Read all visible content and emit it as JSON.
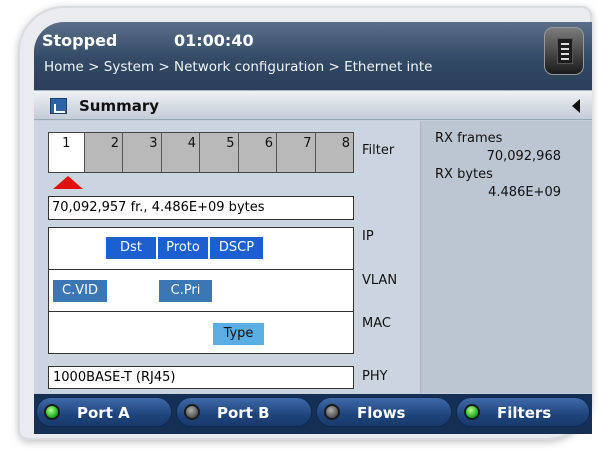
{
  "header": {
    "status": "Stopped",
    "time": "01:00:40",
    "breadcrumb": "Home > System > Network configuration > Ethernet inte",
    "menu_icon": "document-menu-icon"
  },
  "section": {
    "title": "Summary"
  },
  "filter": {
    "label": "Filter",
    "cells": [
      "1",
      "2",
      "3",
      "4",
      "5",
      "6",
      "7",
      "8"
    ],
    "selected": "1"
  },
  "frames_summary": "70,092,957 fr., 4.486E+09 bytes",
  "layers": {
    "ip": "IP",
    "vlan": "VLAN",
    "mac": "MAC",
    "phy": "PHY"
  },
  "ip_fields": [
    "Dst",
    "Proto",
    "DSCP"
  ],
  "vlan_fields": [
    "C.VID",
    "C.Pri"
  ],
  "mac_fields": [
    "Type"
  ],
  "phy_value": "1000BASE-T (RJ45)",
  "stats": {
    "rx_frames_label": "RX frames",
    "rx_frames_value": "70,092,968",
    "rx_bytes_label": "RX bytes",
    "rx_bytes_value": "4.486E+09"
  },
  "ports": [
    {
      "label": "Port A",
      "state": "green"
    },
    {
      "label": "Port B",
      "state": "gray"
    },
    {
      "label": "Flows",
      "state": "gray"
    },
    {
      "label": "Filters",
      "state": "green"
    }
  ],
  "colors": {
    "header": "#324a66",
    "tag_selected": "#1b5fd0",
    "tag_vlan": "#3b77b4",
    "tag_mac": "#5aaee4",
    "marker": "#e01010",
    "led_green": "#24b52a"
  }
}
